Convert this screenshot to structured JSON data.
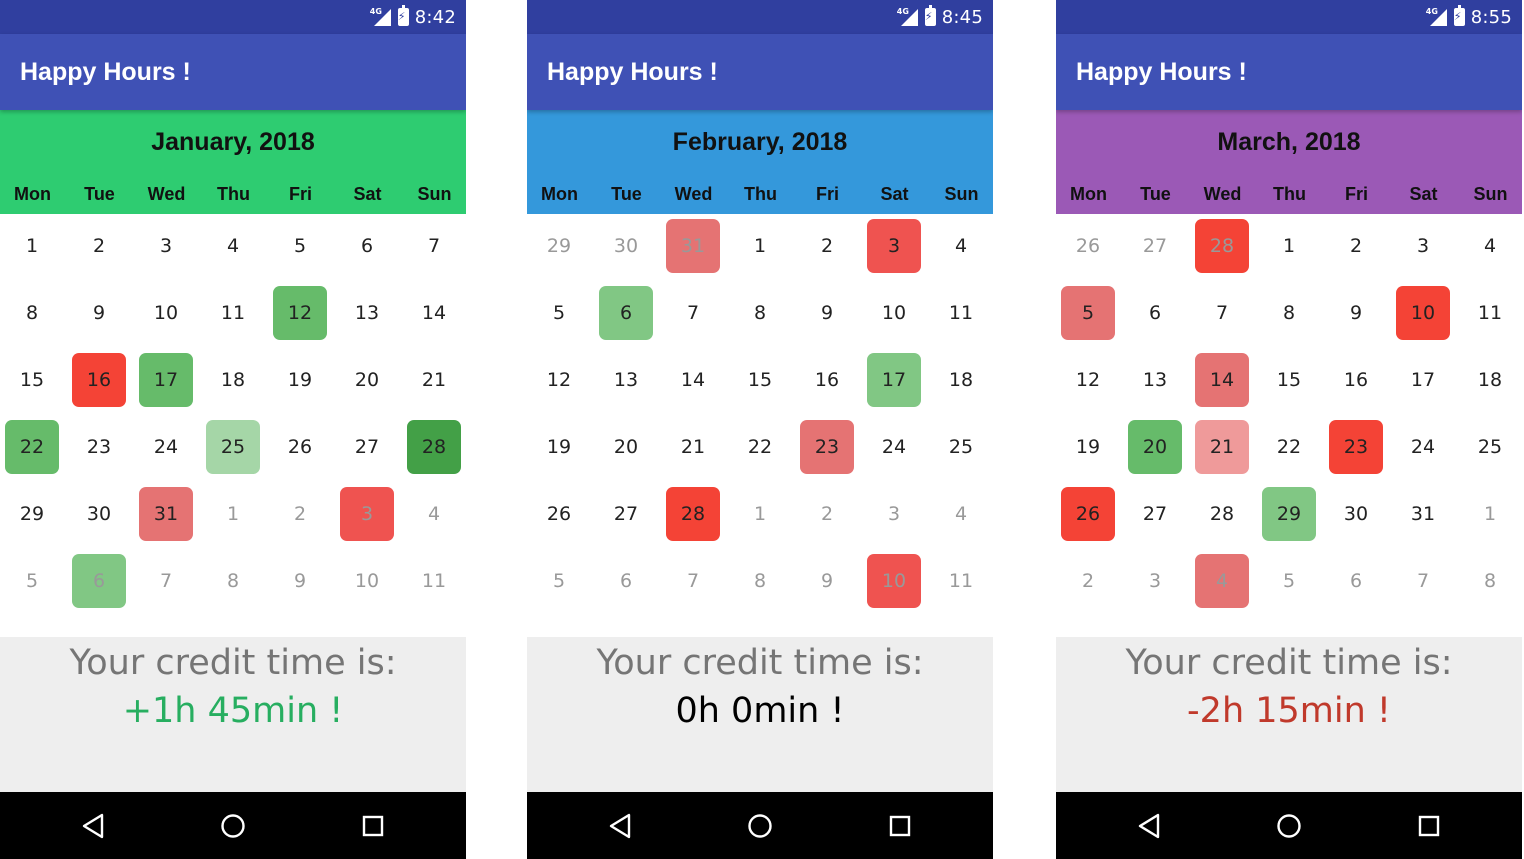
{
  "colors": {
    "status_bar": "#303F9F",
    "app_bar": "#3F51B5",
    "good": "#27AE60",
    "neutral": "#000000",
    "bad": "#C0392B"
  },
  "weekdays": [
    "Mon",
    "Tue",
    "Wed",
    "Thu",
    "Fri",
    "Sat",
    "Sun"
  ],
  "nav_icons": [
    "back-icon",
    "home-icon",
    "recents-icon"
  ],
  "screens": [
    {
      "time": "8:42",
      "app_title": "Happy Hours !",
      "month": "January, 2018",
      "header_color": "#2ECC71",
      "credit_label": "Your credit time is:",
      "credit_value": "+1h 45min !",
      "credit_color": "#27AE60",
      "days": [
        [
          "1",
          "2",
          "3",
          "4",
          "5",
          "6",
          "7"
        ],
        [
          "8",
          "9",
          "10",
          "11",
          "12",
          "13",
          "14"
        ],
        [
          "15",
          "16",
          "17",
          "18",
          "19",
          "20",
          "21"
        ],
        [
          "22",
          "23",
          "24",
          "25",
          "26",
          "27",
          "28"
        ],
        [
          "29",
          "30",
          "31",
          "1",
          "2",
          "3",
          "4"
        ],
        [
          "5",
          "6",
          "7",
          "8",
          "9",
          "10",
          "11"
        ]
      ],
      "other_month": [
        [
          0,
          0,
          0,
          0,
          0,
          0,
          0
        ],
        [
          0,
          0,
          0,
          0,
          0,
          0,
          0
        ],
        [
          0,
          0,
          0,
          0,
          0,
          0,
          0
        ],
        [
          0,
          0,
          0,
          0,
          0,
          0,
          0
        ],
        [
          0,
          0,
          0,
          1,
          1,
          1,
          1
        ],
        [
          1,
          1,
          1,
          1,
          1,
          1,
          1
        ]
      ],
      "highlights": [
        {
          "row": 1,
          "col": 4,
          "color": "#66BB6A"
        },
        {
          "row": 2,
          "col": 1,
          "color": "#F44336"
        },
        {
          "row": 2,
          "col": 2,
          "color": "#66BB6A"
        },
        {
          "row": 3,
          "col": 0,
          "color": "#66BB6A"
        },
        {
          "row": 3,
          "col": 3,
          "color": "#A5D6A7"
        },
        {
          "row": 3,
          "col": 6,
          "color": "#43A047"
        },
        {
          "row": 4,
          "col": 2,
          "color": "#E57373"
        },
        {
          "row": 4,
          "col": 5,
          "color": "#EF5350"
        },
        {
          "row": 5,
          "col": 1,
          "color": "#81C784"
        }
      ]
    },
    {
      "time": "8:45",
      "app_title": "Happy Hours !",
      "month": "February, 2018",
      "header_color": "#3498DB",
      "credit_label": "Your credit time is:",
      "credit_value": "0h 0min !",
      "credit_color": "#000000",
      "days": [
        [
          "29",
          "30",
          "31",
          "1",
          "2",
          "3",
          "4"
        ],
        [
          "5",
          "6",
          "7",
          "8",
          "9",
          "10",
          "11"
        ],
        [
          "12",
          "13",
          "14",
          "15",
          "16",
          "17",
          "18"
        ],
        [
          "19",
          "20",
          "21",
          "22",
          "23",
          "24",
          "25"
        ],
        [
          "26",
          "27",
          "28",
          "1",
          "2",
          "3",
          "4"
        ],
        [
          "5",
          "6",
          "7",
          "8",
          "9",
          "10",
          "11"
        ]
      ],
      "other_month": [
        [
          1,
          1,
          1,
          0,
          0,
          0,
          0
        ],
        [
          0,
          0,
          0,
          0,
          0,
          0,
          0
        ],
        [
          0,
          0,
          0,
          0,
          0,
          0,
          0
        ],
        [
          0,
          0,
          0,
          0,
          0,
          0,
          0
        ],
        [
          0,
          0,
          0,
          1,
          1,
          1,
          1
        ],
        [
          1,
          1,
          1,
          1,
          1,
          1,
          1
        ]
      ],
      "highlights": [
        {
          "row": 0,
          "col": 2,
          "color": "#E57373"
        },
        {
          "row": 0,
          "col": 5,
          "color": "#EF5350"
        },
        {
          "row": 1,
          "col": 1,
          "color": "#81C784"
        },
        {
          "row": 2,
          "col": 5,
          "color": "#81C784"
        },
        {
          "row": 3,
          "col": 4,
          "color": "#E57373"
        },
        {
          "row": 4,
          "col": 2,
          "color": "#F44336"
        },
        {
          "row": 5,
          "col": 5,
          "color": "#EF5350"
        }
      ]
    },
    {
      "time": "8:55",
      "app_title": "Happy Hours !",
      "month": "March, 2018",
      "header_color": "#9B59B6",
      "credit_label": "Your credit time is:",
      "credit_value": "-2h 15min !",
      "credit_color": "#C0392B",
      "days": [
        [
          "26",
          "27",
          "28",
          "1",
          "2",
          "3",
          "4"
        ],
        [
          "5",
          "6",
          "7",
          "8",
          "9",
          "10",
          "11"
        ],
        [
          "12",
          "13",
          "14",
          "15",
          "16",
          "17",
          "18"
        ],
        [
          "19",
          "20",
          "21",
          "22",
          "23",
          "24",
          "25"
        ],
        [
          "26",
          "27",
          "28",
          "29",
          "30",
          "31",
          "1"
        ],
        [
          "2",
          "3",
          "4",
          "5",
          "6",
          "7",
          "8"
        ]
      ],
      "other_month": [
        [
          1,
          1,
          1,
          0,
          0,
          0,
          0
        ],
        [
          0,
          0,
          0,
          0,
          0,
          0,
          0
        ],
        [
          0,
          0,
          0,
          0,
          0,
          0,
          0
        ],
        [
          0,
          0,
          0,
          0,
          0,
          0,
          0
        ],
        [
          0,
          0,
          0,
          0,
          0,
          0,
          1
        ],
        [
          1,
          1,
          1,
          1,
          1,
          1,
          1
        ]
      ],
      "highlights": [
        {
          "row": 0,
          "col": 2,
          "color": "#F44336"
        },
        {
          "row": 1,
          "col": 0,
          "color": "#E57373"
        },
        {
          "row": 1,
          "col": 5,
          "color": "#F44336"
        },
        {
          "row": 2,
          "col": 2,
          "color": "#E57373"
        },
        {
          "row": 3,
          "col": 1,
          "color": "#66BB6A"
        },
        {
          "row": 3,
          "col": 2,
          "color": "#EF9A9A"
        },
        {
          "row": 3,
          "col": 4,
          "color": "#F44336"
        },
        {
          "row": 4,
          "col": 0,
          "color": "#F44336"
        },
        {
          "row": 4,
          "col": 3,
          "color": "#81C784"
        },
        {
          "row": 5,
          "col": 2,
          "color": "#E57373"
        }
      ]
    }
  ]
}
